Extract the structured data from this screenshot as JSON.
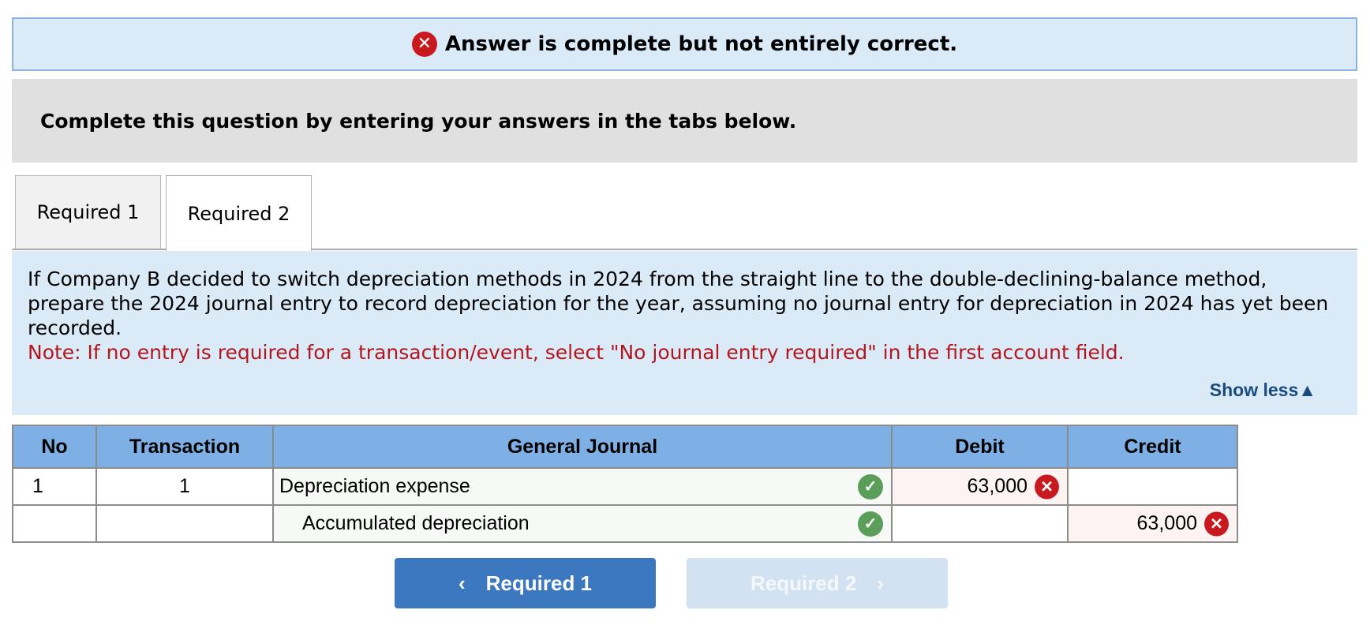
{
  "banner": {
    "icon": "x-circle-icon",
    "message": "Answer is complete but not entirely correct.",
    "icon_color": "#c8191f"
  },
  "instructions": {
    "text": "Complete this question by entering your answers in the tabs below."
  },
  "tabs": [
    {
      "label": "Required 1",
      "active": false
    },
    {
      "label": "Required 2",
      "active": true
    }
  ],
  "question": {
    "text": "If Company B decided to switch depreciation methods in 2024 from the straight line to the double-declining-balance method, prepare the 2024 journal entry to record depreciation for the year, assuming no journal entry for depreciation in 2024 has yet been recorded.",
    "note": "Note: If no entry is required for a transaction/event, select \"No journal entry required\" in the first account field.",
    "show_less": "Show less"
  },
  "journal": {
    "headers": {
      "no": "No",
      "transaction": "Transaction",
      "general_journal": "General Journal",
      "debit": "Debit",
      "credit": "Credit"
    },
    "rows": [
      {
        "no": "1",
        "transaction": "1",
        "account": "Depreciation expense",
        "account_status": "correct",
        "debit": "63,000",
        "debit_status": "incorrect",
        "credit": ""
      },
      {
        "no": "",
        "transaction": "",
        "account": "Accumulated depreciation",
        "account_status": "correct",
        "debit": "",
        "credit": "63,000",
        "credit_status": "incorrect"
      }
    ]
  },
  "nav": {
    "prev_label": "Required 1",
    "next_label": "Required 2",
    "next_enabled": false
  },
  "colors": {
    "accent_blue": "#3b78bf",
    "header_blue": "#7eb0e6",
    "panel_blue": "#dbeaf7",
    "note_red": "#b3161e",
    "correct_green": "#5a9e5a"
  }
}
